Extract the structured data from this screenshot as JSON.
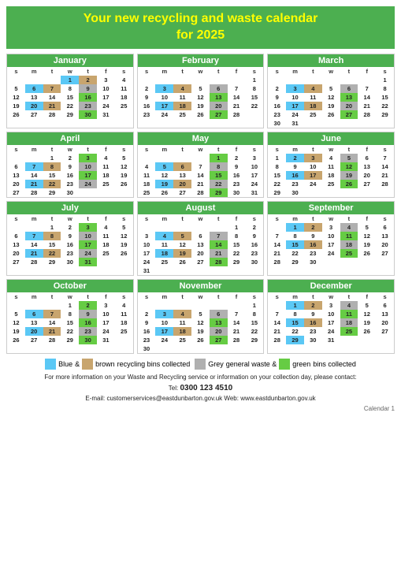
{
  "header": {
    "line1": "Your new recycling and waste calendar",
    "line2": "for 2025"
  },
  "legend": {
    "blue_label": "Blue",
    "brown_label": "brown",
    "recycling_text": "recycling bins collected",
    "grey_label": "Grey",
    "green_label": "green",
    "waste_text": "general waste &",
    "bins_text": "bins collected"
  },
  "footer": {
    "line1": "For more information on your Waste and Recycling service or information on your collection day, please contact:",
    "tel_label": "Tel:",
    "tel_number": "0300 123 4510",
    "email_label": "E-mail:",
    "email": "customerservices@eastdunbarton.gov.uk",
    "web_label": "Web:",
    "web": "www.eastdunbarton.gov.uk",
    "page": "Calendar 1"
  },
  "months": [
    {
      "name": "January",
      "headers": [
        "s",
        "m",
        "t",
        "w",
        "t",
        "f",
        "s"
      ],
      "weeks": [
        [
          null,
          null,
          null,
          1,
          2,
          3,
          4
        ],
        [
          5,
          6,
          7,
          8,
          9,
          10,
          11
        ],
        [
          12,
          13,
          14,
          15,
          16,
          17,
          18
        ],
        [
          19,
          20,
          21,
          22,
          23,
          24,
          25
        ],
        [
          26,
          27,
          28,
          29,
          30,
          31,
          null
        ]
      ],
      "colored": {
        "blue": [
          1,
          6,
          20
        ],
        "brown": [
          2,
          7,
          21
        ],
        "grey": [
          9,
          23
        ],
        "green": [
          16,
          30
        ]
      }
    },
    {
      "name": "February",
      "headers": [
        "s",
        "m",
        "t",
        "w",
        "t",
        "f",
        "s"
      ],
      "weeks": [
        [
          null,
          null,
          null,
          null,
          null,
          null,
          1
        ],
        [
          2,
          3,
          4,
          5,
          6,
          7,
          8
        ],
        [
          9,
          10,
          11,
          12,
          13,
          14,
          15
        ],
        [
          16,
          17,
          18,
          19,
          20,
          21,
          22
        ],
        [
          23,
          24,
          25,
          26,
          27,
          28,
          null
        ]
      ],
      "colored": {
        "blue": [
          3,
          17
        ],
        "brown": [
          4,
          18
        ],
        "grey": [
          6,
          20
        ],
        "green": [
          13,
          27
        ]
      }
    },
    {
      "name": "March",
      "headers": [
        "s",
        "m",
        "t",
        "w",
        "t",
        "f",
        "s"
      ],
      "weeks": [
        [
          null,
          null,
          null,
          null,
          null,
          null,
          1
        ],
        [
          2,
          3,
          4,
          5,
          6,
          7,
          8
        ],
        [
          9,
          10,
          11,
          12,
          13,
          14,
          15
        ],
        [
          16,
          17,
          18,
          19,
          20,
          21,
          22
        ],
        [
          23,
          24,
          25,
          26,
          27,
          28,
          29
        ],
        [
          30,
          31,
          null,
          null,
          null,
          null,
          null
        ]
      ],
      "colored": {
        "blue": [
          3,
          17
        ],
        "brown": [
          4,
          18
        ],
        "grey": [
          6,
          20
        ],
        "green": [
          13,
          27
        ]
      }
    },
    {
      "name": "April",
      "headers": [
        "s",
        "m",
        "t",
        "w",
        "t",
        "f",
        "s"
      ],
      "weeks": [
        [
          null,
          null,
          1,
          2,
          3,
          4,
          5
        ],
        [
          6,
          7,
          8,
          9,
          10,
          11,
          12
        ],
        [
          13,
          14,
          15,
          16,
          17,
          18,
          19
        ],
        [
          20,
          21,
          22,
          23,
          24,
          25,
          26
        ],
        [
          27,
          28,
          29,
          30,
          null,
          null,
          null
        ]
      ],
      "colored": {
        "blue": [
          7,
          21
        ],
        "brown": [
          8,
          22
        ],
        "grey": [
          10,
          24
        ],
        "green": [
          3,
          17
        ]
      }
    },
    {
      "name": "May",
      "headers": [
        "s",
        "m",
        "t",
        "w",
        "t",
        "f",
        "s"
      ],
      "weeks": [
        [
          null,
          null,
          null,
          null,
          1,
          2,
          3
        ],
        [
          4,
          5,
          6,
          7,
          8,
          9,
          10
        ],
        [
          11,
          12,
          13,
          14,
          15,
          16,
          17
        ],
        [
          18,
          19,
          20,
          21,
          22,
          23,
          24
        ],
        [
          25,
          26,
          27,
          28,
          29,
          30,
          31
        ]
      ],
      "colored": {
        "blue": [
          5,
          19
        ],
        "brown": [
          6,
          20
        ],
        "grey": [
          8,
          22
        ],
        "green": [
          1,
          15,
          29
        ]
      }
    },
    {
      "name": "June",
      "headers": [
        "s",
        "m",
        "t",
        "w",
        "t",
        "f",
        "s"
      ],
      "weeks": [
        [
          1,
          2,
          3,
          4,
          5,
          6,
          7
        ],
        [
          8,
          9,
          10,
          11,
          12,
          13,
          14
        ],
        [
          15,
          16,
          17,
          18,
          19,
          20,
          21
        ],
        [
          22,
          23,
          24,
          25,
          26,
          27,
          28
        ],
        [
          29,
          30,
          null,
          null,
          null,
          null,
          null
        ]
      ],
      "colored": {
        "blue": [
          2,
          16
        ],
        "brown": [
          3,
          17
        ],
        "grey": [
          5,
          19
        ],
        "green": [
          12,
          26
        ]
      }
    },
    {
      "name": "July",
      "headers": [
        "s",
        "m",
        "t",
        "w",
        "t",
        "f",
        "s"
      ],
      "weeks": [
        [
          null,
          null,
          1,
          2,
          3,
          4,
          5
        ],
        [
          6,
          7,
          8,
          9,
          10,
          11,
          12
        ],
        [
          13,
          14,
          15,
          16,
          17,
          18,
          19
        ],
        [
          20,
          21,
          22,
          23,
          24,
          25,
          26
        ],
        [
          27,
          28,
          29,
          30,
          31,
          null,
          null
        ]
      ],
      "colored": {
        "blue": [
          7,
          21
        ],
        "brown": [
          8,
          22
        ],
        "grey": [
          10,
          24
        ],
        "green": [
          3,
          17,
          31
        ]
      }
    },
    {
      "name": "August",
      "headers": [
        "s",
        "m",
        "t",
        "w",
        "t",
        "f",
        "s"
      ],
      "weeks": [
        [
          null,
          null,
          null,
          null,
          null,
          1,
          2
        ],
        [
          3,
          4,
          5,
          6,
          7,
          8,
          9
        ],
        [
          10,
          11,
          12,
          13,
          14,
          15,
          16
        ],
        [
          17,
          18,
          19,
          20,
          21,
          22,
          23
        ],
        [
          24,
          25,
          26,
          27,
          28,
          29,
          30
        ],
        [
          31,
          null,
          null,
          null,
          null,
          null,
          null
        ]
      ],
      "colored": {
        "blue": [
          4,
          18
        ],
        "brown": [
          5,
          19
        ],
        "grey": [
          7,
          21
        ],
        "green": [
          14,
          28
        ]
      }
    },
    {
      "name": "September",
      "headers": [
        "s",
        "m",
        "t",
        "w",
        "t",
        "f",
        "s"
      ],
      "weeks": [
        [
          null,
          1,
          2,
          3,
          4,
          5,
          6
        ],
        [
          7,
          8,
          9,
          10,
          11,
          12,
          13
        ],
        [
          14,
          15,
          16,
          17,
          18,
          19,
          20
        ],
        [
          21,
          22,
          23,
          24,
          25,
          26,
          27
        ],
        [
          28,
          29,
          30,
          null,
          null,
          null,
          null
        ]
      ],
      "colored": {
        "blue": [
          1,
          15
        ],
        "brown": [
          2,
          16
        ],
        "grey": [
          4,
          18
        ],
        "green": [
          11,
          25
        ]
      }
    },
    {
      "name": "October",
      "headers": [
        "s",
        "m",
        "t",
        "w",
        "t",
        "f",
        "s"
      ],
      "weeks": [
        [
          null,
          null,
          null,
          1,
          2,
          3,
          4
        ],
        [
          5,
          6,
          7,
          8,
          9,
          10,
          11
        ],
        [
          12,
          13,
          14,
          15,
          16,
          17,
          18
        ],
        [
          19,
          20,
          21,
          22,
          23,
          24,
          25
        ],
        [
          26,
          27,
          28,
          29,
          30,
          31,
          null
        ]
      ],
      "colored": {
        "blue": [
          6,
          20
        ],
        "brown": [
          7,
          21
        ],
        "grey": [
          9,
          23
        ],
        "green": [
          2,
          16,
          30
        ]
      }
    },
    {
      "name": "November",
      "headers": [
        "s",
        "m",
        "t",
        "w",
        "t",
        "f",
        "s"
      ],
      "weeks": [
        [
          null,
          null,
          null,
          null,
          null,
          null,
          1
        ],
        [
          2,
          3,
          4,
          5,
          6,
          7,
          8
        ],
        [
          9,
          10,
          11,
          12,
          13,
          14,
          15
        ],
        [
          16,
          17,
          18,
          19,
          20,
          21,
          22
        ],
        [
          23,
          24,
          25,
          26,
          27,
          28,
          29
        ],
        [
          30,
          null,
          null,
          null,
          null,
          null,
          null
        ]
      ],
      "colored": {
        "blue": [
          3,
          17
        ],
        "brown": [
          4,
          18
        ],
        "grey": [
          6,
          20
        ],
        "green": [
          13,
          27
        ]
      }
    },
    {
      "name": "December",
      "headers": [
        "s",
        "m",
        "t",
        "w",
        "t",
        "f",
        "s"
      ],
      "weeks": [
        [
          null,
          1,
          2,
          3,
          4,
          5,
          6
        ],
        [
          7,
          8,
          9,
          10,
          11,
          12,
          13
        ],
        [
          14,
          15,
          16,
          17,
          18,
          19,
          20
        ],
        [
          21,
          22,
          23,
          24,
          25,
          26,
          27
        ],
        [
          28,
          29,
          30,
          31,
          null,
          null,
          null
        ]
      ],
      "colored": {
        "blue": [
          1,
          15,
          29
        ],
        "brown": [
          2,
          16
        ],
        "grey": [
          4,
          18
        ],
        "green": [
          11,
          25
        ]
      }
    }
  ]
}
